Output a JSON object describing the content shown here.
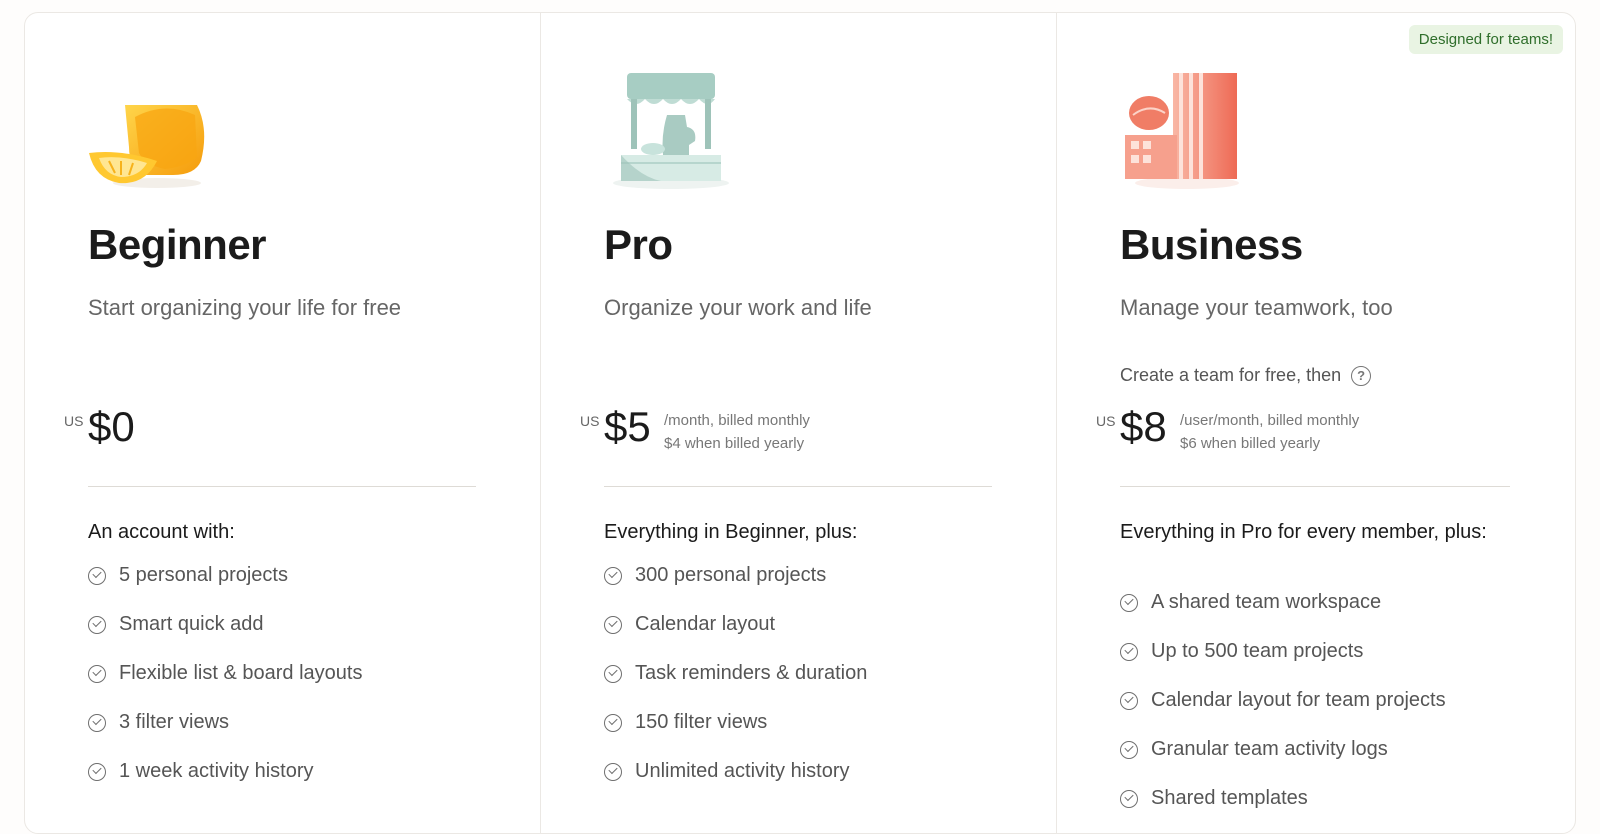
{
  "plans": [
    {
      "name": "Beginner",
      "tagline": "Start organizing your life for free",
      "currency": "US",
      "price": "$0",
      "billing_line1": "",
      "billing_line2": "",
      "features_heading": "An account with:",
      "features": [
        "5 personal projects",
        "Smart quick add",
        "Flexible list & board layouts",
        "3 filter views",
        "1 week activity history"
      ],
      "illustration": "lemonade-glass-icon"
    },
    {
      "name": "Pro",
      "tagline": "Organize your work and life",
      "currency": "US",
      "price": "$5",
      "billing_line1": "/month, billed monthly",
      "billing_line2": "$4 when billed yearly",
      "features_heading": "Everything in Beginner, plus:",
      "features": [
        "300 personal projects",
        "Calendar layout",
        "Task reminders & duration",
        "150 filter views",
        "Unlimited activity history"
      ],
      "illustration": "lemonade-stand-icon"
    },
    {
      "name": "Business",
      "badge": "Designed for teams!",
      "tagline": "Manage your teamwork, too",
      "team_note": "Create a team for free, then",
      "currency": "US",
      "price": "$8",
      "billing_line1": "/user/month, billed monthly",
      "billing_line2": "$6 when billed yearly",
      "features_heading": "Everything in Pro for every member, plus:",
      "features": [
        "A shared team workspace",
        "Up to 500 team projects",
        "Calendar layout for team projects",
        "Granular team activity logs",
        "Shared templates"
      ],
      "illustration": "office-buildings-icon"
    }
  ],
  "colors": {
    "badge_bg": "#e9f4e3",
    "badge_text": "#2f6e2b",
    "beginner_accent": "#f7b21b",
    "pro_accent": "#9cc7bd",
    "business_accent": "#f27b64"
  }
}
